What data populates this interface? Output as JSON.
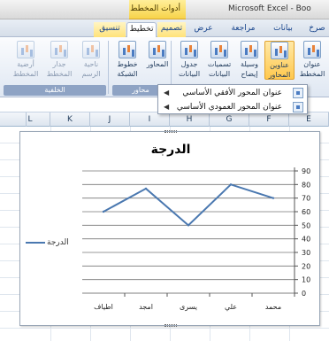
{
  "window": {
    "app_title": "Microsoft Excel - Boo",
    "contextual_group": "أدوات المخطط"
  },
  "tabs": [
    {
      "label": "صرخ",
      "active": false,
      "contextual": false
    },
    {
      "label": "بيانات",
      "active": false,
      "contextual": false
    },
    {
      "label": "مراجعة",
      "active": false,
      "contextual": false
    },
    {
      "label": "عرض",
      "active": false,
      "contextual": false
    },
    {
      "label": "تصميم",
      "active": false,
      "contextual": true
    },
    {
      "label": "تخطيط",
      "active": true,
      "contextual": true
    },
    {
      "label": "تنسيق",
      "active": false,
      "contextual": true
    }
  ],
  "ribbon": {
    "buttons": [
      {
        "label1": "عنوان",
        "label2": "المخطط",
        "state": "normal"
      },
      {
        "label1": "عناوين",
        "label2": "المحاور",
        "state": "highlight"
      },
      {
        "label1": "وسيلة",
        "label2": "إيضاح",
        "state": "normal"
      },
      {
        "label1": "تسميات",
        "label2": "البيانات",
        "state": "normal"
      },
      {
        "label1": "جدول",
        "label2": "البيانات",
        "state": "normal"
      },
      {
        "label1": "المحاور",
        "label2": "",
        "state": "normal"
      },
      {
        "label1": "خطوط",
        "label2": "الشبكة",
        "state": "normal"
      },
      {
        "label1": "ناحية",
        "label2": "الرسم",
        "state": "faded"
      },
      {
        "label1": "جدار",
        "label2": "المخطط",
        "state": "faded"
      },
      {
        "label1": "أرضية",
        "label2": "المخطط",
        "state": "faded"
      }
    ],
    "groups": {
      "axes": "محاور",
      "background": "الخلفية"
    }
  },
  "axis_titles_menu": {
    "items": [
      {
        "label": "عنوان المحور الأفقي الأساسي"
      },
      {
        "label": "عنوان المحور العمودي الأساسي"
      }
    ]
  },
  "columns": [
    "E",
    "F",
    "G",
    "H",
    "I",
    "J",
    "K",
    "L"
  ],
  "chart_data": {
    "type": "line",
    "title": "الدرجة",
    "categories": [
      "محمد",
      "علي",
      "يسرى",
      "امجد",
      "اطياف"
    ],
    "series": [
      {
        "name": "الدرجة",
        "values": [
          70,
          80,
          50,
          77,
          60
        ],
        "color": "#4a78b0"
      }
    ],
    "ylim": [
      0,
      90
    ],
    "yticks": [
      0,
      10,
      20,
      30,
      40,
      50,
      60,
      70,
      80,
      90
    ],
    "x_reversed": true,
    "grid": true,
    "legend": "left"
  }
}
